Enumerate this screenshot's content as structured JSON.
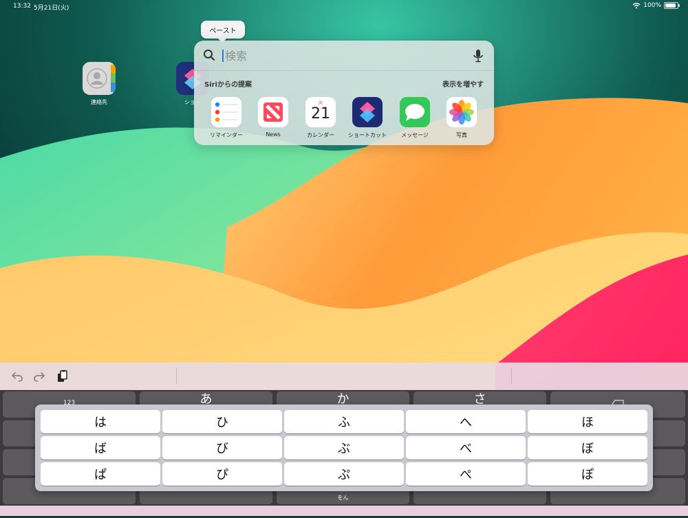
{
  "status_bar": {
    "time": "13:32",
    "date": "5月21日(火)",
    "battery": "100%",
    "battery_level": 1.0
  },
  "home_screen": {
    "apps": [
      {
        "label": "連絡先",
        "icon": "contacts-icon"
      },
      {
        "label": "ショー",
        "icon": "shortcuts-icon"
      }
    ]
  },
  "paste_menu": {
    "label": "ペースト"
  },
  "spotlight": {
    "search": {
      "placeholder": "検索",
      "value": ""
    },
    "siri_title": "Siriからの提案",
    "show_more": "表示を増やす",
    "apps": [
      {
        "label": "リマインダー",
        "icon": "reminders-icon"
      },
      {
        "label": "News",
        "icon": "news-icon"
      },
      {
        "label": "カレンダー",
        "icon": "calendar-icon",
        "weekday": "火",
        "day": "21"
      },
      {
        "label": "ショートカット",
        "icon": "shortcuts-icon"
      },
      {
        "label": "メッセージ",
        "icon": "messages-icon"
      },
      {
        "label": "写真",
        "icon": "photos-icon"
      }
    ]
  },
  "toolbar": {
    "undo": "undo-icon",
    "redo": "redo-icon",
    "paste": "clipboard-icon"
  },
  "keyboard_under": {
    "numbers": "123",
    "a": "あ",
    "ka": "か",
    "sa": "さ",
    "wo": "をん"
  },
  "kana_popup": {
    "rows": [
      [
        "は",
        "ひ",
        "ふ",
        "へ",
        "ほ"
      ],
      [
        "ば",
        "び",
        "ぶ",
        "べ",
        "ぼ"
      ],
      [
        "ぱ",
        "ぴ",
        "ぷ",
        "ぺ",
        "ぽ"
      ]
    ]
  },
  "colors": {
    "accent": "#2f73ea",
    "keyboard": "#3d3a3d",
    "key": "#5c5a5d"
  }
}
